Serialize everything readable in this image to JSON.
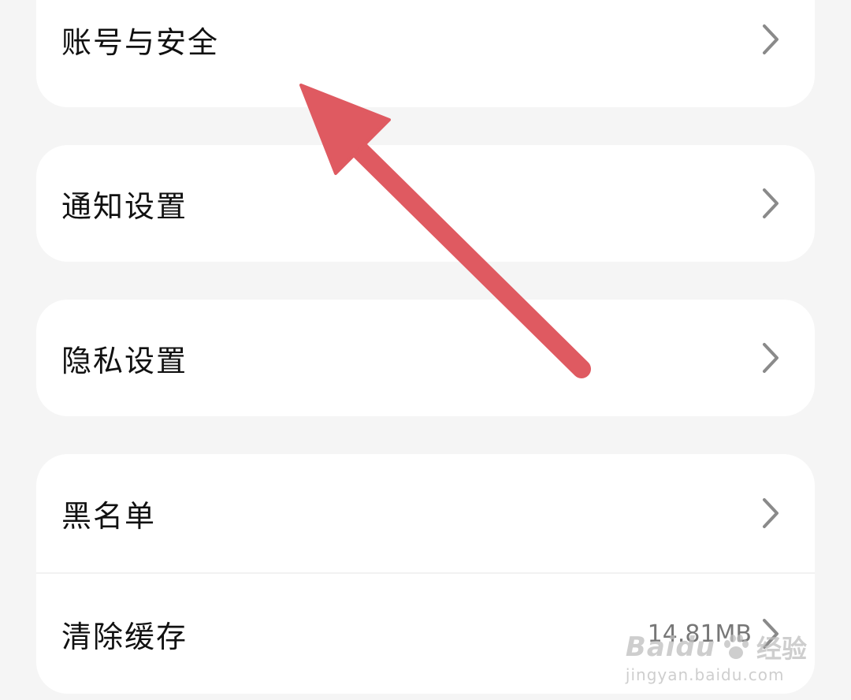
{
  "settings": {
    "items": [
      {
        "label": "账号与安全"
      },
      {
        "label": "通知设置"
      },
      {
        "label": "隐私设置"
      },
      {
        "label": "黑名单"
      },
      {
        "label": "清除缓存",
        "value": "14.81MB"
      }
    ]
  },
  "icons": {
    "chevron": "chevron-right-icon",
    "annotation_arrow": "arrow-up-left-icon"
  },
  "colors": {
    "page_background": "#f5f5f5",
    "card_background": "#ffffff",
    "chevron": "#8a8a8a",
    "annotation_arrow": "#df5a61"
  },
  "watermark": {
    "logo_text": "Baidu",
    "logo_suffix": "经验",
    "url": "jingyan.baidu.com"
  }
}
